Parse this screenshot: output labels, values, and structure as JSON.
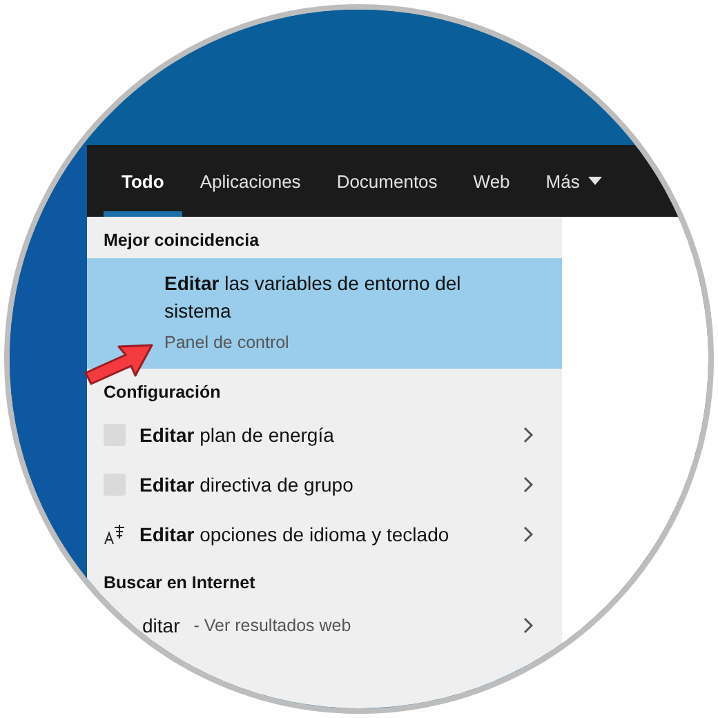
{
  "tabs": [
    {
      "label": "Todo",
      "selected": true
    },
    {
      "label": "Aplicaciones",
      "selected": false
    },
    {
      "label": "Documentos",
      "selected": false
    },
    {
      "label": "Web",
      "selected": false
    },
    {
      "label": "Más",
      "selected": false,
      "dropdown": true
    }
  ],
  "best_match": {
    "heading": "Mejor coincidencia",
    "title": "**Editar** las variables de entorno del sistema",
    "subtitle": "Panel de control",
    "selected": true
  },
  "settings": {
    "heading": "Configuración",
    "items": [
      {
        "kind": "blank",
        "text": "**Editar** plan de energía"
      },
      {
        "kind": "blank",
        "text": "**Editar** directiva de grupo"
      },
      {
        "kind": "language",
        "text": "**Editar** opciones de idioma y teclado"
      }
    ]
  },
  "web": {
    "heading": "Buscar en Internet",
    "query": "ditar",
    "suffix": "- Ver resultados web"
  }
}
